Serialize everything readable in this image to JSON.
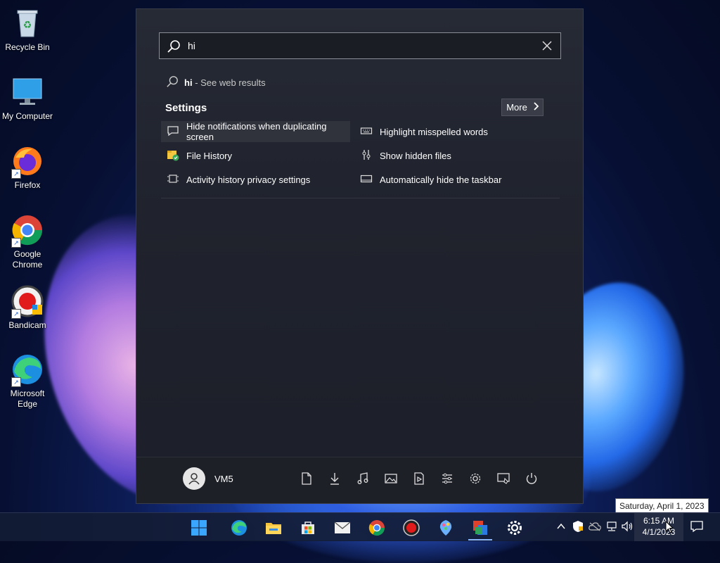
{
  "desktop": {
    "icons": [
      {
        "label": "Recycle Bin",
        "icon": "recycle-bin-icon"
      },
      {
        "label": "My Computer",
        "icon": "monitor-icon"
      },
      {
        "label": "Firefox",
        "icon": "firefox-icon"
      },
      {
        "label": "Google Chrome",
        "icon": "chrome-icon"
      },
      {
        "label": "Bandicam",
        "icon": "bandicam-icon"
      },
      {
        "label": "Microsoft Edge",
        "icon": "edge-icon"
      }
    ]
  },
  "search": {
    "query": "hi",
    "web_query": "hi",
    "web_suffix": "- See web results"
  },
  "settings": {
    "heading": "Settings",
    "more_label": "More",
    "results": [
      {
        "label": "Hide notifications when duplicating screen",
        "icon": "notification-icon"
      },
      {
        "label": "Highlight misspelled words",
        "icon": "keyboard-icon"
      },
      {
        "label": "File History",
        "icon": "file-history-icon"
      },
      {
        "label": "Show hidden files",
        "icon": "hidden-files-icon"
      },
      {
        "label": "Activity history privacy settings",
        "icon": "activity-history-icon"
      },
      {
        "label": "Automatically hide the taskbar",
        "icon": "taskbar-icon"
      }
    ]
  },
  "start_footer": {
    "user_name": "VM5",
    "quick_links": [
      "documents-icon",
      "downloads-icon",
      "music-icon",
      "pictures-icon",
      "videos-icon",
      "network-settings-icon",
      "settings-icon",
      "personalization-icon",
      "power-icon"
    ]
  },
  "taskbar": {
    "apps": [
      "start-icon",
      "edge-icon",
      "file-explorer-icon",
      "store-icon",
      "mail-icon",
      "chrome-icon",
      "bandicam-icon",
      "paint-icon",
      "office-icon",
      "settings-icon"
    ],
    "tray": [
      "chevron-up-icon",
      "security-icon",
      "onedrive-icon",
      "network-icon",
      "volume-icon"
    ],
    "time": "6:15 AM",
    "date": "4/1/2023",
    "tooltip": "Saturday, April 1, 2023"
  },
  "colors": {
    "accent": "#0078d4",
    "panel": "#22252e"
  }
}
